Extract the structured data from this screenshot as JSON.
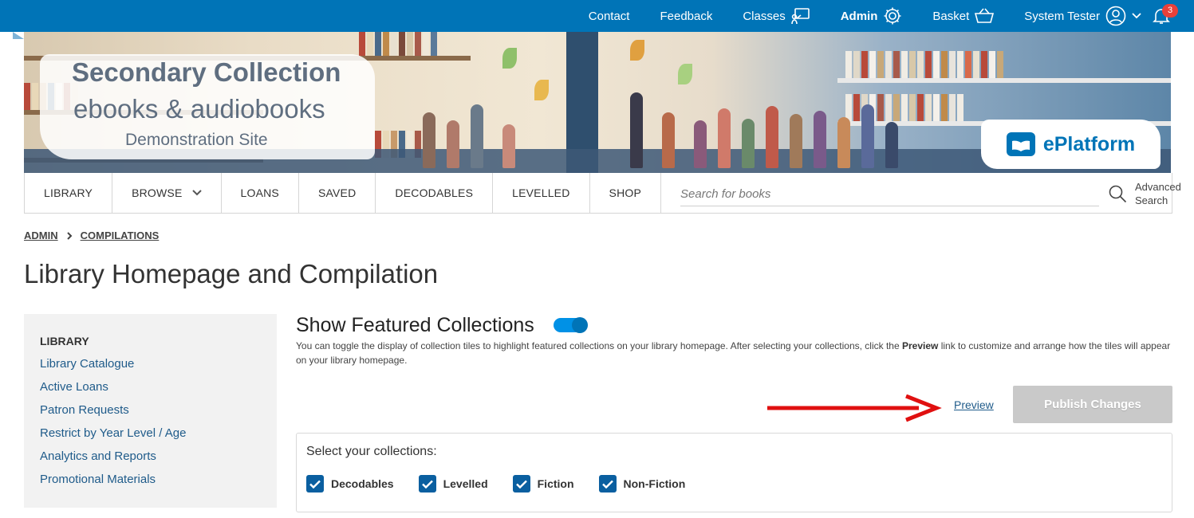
{
  "topnav": {
    "contact": "Contact",
    "feedback": "Feedback",
    "classes": "Classes",
    "admin": "Admin",
    "basket": "Basket",
    "user": "System Tester",
    "notifications_count": "3"
  },
  "banner": {
    "line1": "Secondary Collection",
    "line2": "ebooks & audiobooks",
    "line3": "Demonstration Site",
    "logo_text": "ePlatform"
  },
  "mainnav": {
    "items": [
      "LIBRARY",
      "BROWSE",
      "LOANS",
      "SAVED",
      "DECODABLES",
      "LEVELLED",
      "SHOP"
    ],
    "search_placeholder": "Search for books",
    "advanced_line1": "Advanced",
    "advanced_line2": "Search"
  },
  "breadcrumb": {
    "admin": "ADMIN",
    "compilations": "COMPILATIONS"
  },
  "page_title": "Library Homepage and Compilation",
  "sidebar": {
    "heading": "LIBRARY",
    "items": [
      "Library Catalogue",
      "Active Loans",
      "Patron Requests",
      "Restrict by Year Level / Age",
      "Analytics and Reports",
      "Promotional Materials"
    ]
  },
  "featured": {
    "title": "Show Featured Collections",
    "toggle_on": true,
    "desc_before": "You can toggle the display of collection tiles to highlight featured collections on your library homepage. After selecting your collections, click the ",
    "desc_bold": "Preview",
    "desc_after": " link to customize and arrange how the tiles will appear on your library homepage.",
    "preview_label": "Preview",
    "publish_label": "Publish Changes"
  },
  "collections": {
    "label": "Select your collections:",
    "options": [
      {
        "label": "Decodables",
        "checked": true
      },
      {
        "label": "Levelled",
        "checked": true
      },
      {
        "label": "Fiction",
        "checked": true
      },
      {
        "label": "Non-Fiction",
        "checked": true
      }
    ]
  },
  "colors": {
    "primary": "#0074b7",
    "annotation_arrow": "#e01010",
    "disabled_button": "#c9c9c9"
  }
}
